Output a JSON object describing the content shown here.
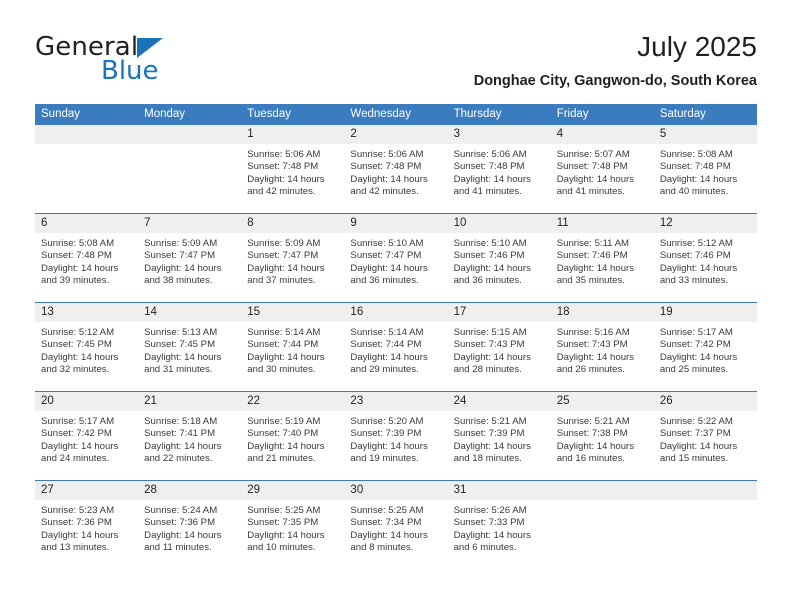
{
  "logo": {
    "word1": "General",
    "word2": "Blue",
    "triangle_color": "#1a73bb"
  },
  "header": {
    "title": "July 2025",
    "subtitle": "Donghae City, Gangwon-do, South Korea"
  },
  "theme": {
    "header_blue": "#3b7cbf",
    "daynum_bg": "#efefef",
    "text": "#231f20"
  },
  "weekday_headers": [
    "Sunday",
    "Monday",
    "Tuesday",
    "Wednesday",
    "Thursday",
    "Friday",
    "Saturday"
  ],
  "weeks": [
    [
      {
        "day": "",
        "sunrise": "",
        "sunset": "",
        "daylight_1": "",
        "daylight_2": ""
      },
      {
        "day": "",
        "sunrise": "",
        "sunset": "",
        "daylight_1": "",
        "daylight_2": ""
      },
      {
        "day": "1",
        "sunrise": "Sunrise: 5:06 AM",
        "sunset": "Sunset: 7:48 PM",
        "daylight_1": "Daylight: 14 hours",
        "daylight_2": "and 42 minutes."
      },
      {
        "day": "2",
        "sunrise": "Sunrise: 5:06 AM",
        "sunset": "Sunset: 7:48 PM",
        "daylight_1": "Daylight: 14 hours",
        "daylight_2": "and 42 minutes."
      },
      {
        "day": "3",
        "sunrise": "Sunrise: 5:06 AM",
        "sunset": "Sunset: 7:48 PM",
        "daylight_1": "Daylight: 14 hours",
        "daylight_2": "and 41 minutes."
      },
      {
        "day": "4",
        "sunrise": "Sunrise: 5:07 AM",
        "sunset": "Sunset: 7:48 PM",
        "daylight_1": "Daylight: 14 hours",
        "daylight_2": "and 41 minutes."
      },
      {
        "day": "5",
        "sunrise": "Sunrise: 5:08 AM",
        "sunset": "Sunset: 7:48 PM",
        "daylight_1": "Daylight: 14 hours",
        "daylight_2": "and 40 minutes."
      }
    ],
    [
      {
        "day": "6",
        "sunrise": "Sunrise: 5:08 AM",
        "sunset": "Sunset: 7:48 PM",
        "daylight_1": "Daylight: 14 hours",
        "daylight_2": "and 39 minutes."
      },
      {
        "day": "7",
        "sunrise": "Sunrise: 5:09 AM",
        "sunset": "Sunset: 7:47 PM",
        "daylight_1": "Daylight: 14 hours",
        "daylight_2": "and 38 minutes."
      },
      {
        "day": "8",
        "sunrise": "Sunrise: 5:09 AM",
        "sunset": "Sunset: 7:47 PM",
        "daylight_1": "Daylight: 14 hours",
        "daylight_2": "and 37 minutes."
      },
      {
        "day": "9",
        "sunrise": "Sunrise: 5:10 AM",
        "sunset": "Sunset: 7:47 PM",
        "daylight_1": "Daylight: 14 hours",
        "daylight_2": "and 36 minutes."
      },
      {
        "day": "10",
        "sunrise": "Sunrise: 5:10 AM",
        "sunset": "Sunset: 7:46 PM",
        "daylight_1": "Daylight: 14 hours",
        "daylight_2": "and 36 minutes."
      },
      {
        "day": "11",
        "sunrise": "Sunrise: 5:11 AM",
        "sunset": "Sunset: 7:46 PM",
        "daylight_1": "Daylight: 14 hours",
        "daylight_2": "and 35 minutes."
      },
      {
        "day": "12",
        "sunrise": "Sunrise: 5:12 AM",
        "sunset": "Sunset: 7:46 PM",
        "daylight_1": "Daylight: 14 hours",
        "daylight_2": "and 33 minutes."
      }
    ],
    [
      {
        "day": "13",
        "sunrise": "Sunrise: 5:12 AM",
        "sunset": "Sunset: 7:45 PM",
        "daylight_1": "Daylight: 14 hours",
        "daylight_2": "and 32 minutes."
      },
      {
        "day": "14",
        "sunrise": "Sunrise: 5:13 AM",
        "sunset": "Sunset: 7:45 PM",
        "daylight_1": "Daylight: 14 hours",
        "daylight_2": "and 31 minutes."
      },
      {
        "day": "15",
        "sunrise": "Sunrise: 5:14 AM",
        "sunset": "Sunset: 7:44 PM",
        "daylight_1": "Daylight: 14 hours",
        "daylight_2": "and 30 minutes."
      },
      {
        "day": "16",
        "sunrise": "Sunrise: 5:14 AM",
        "sunset": "Sunset: 7:44 PM",
        "daylight_1": "Daylight: 14 hours",
        "daylight_2": "and 29 minutes."
      },
      {
        "day": "17",
        "sunrise": "Sunrise: 5:15 AM",
        "sunset": "Sunset: 7:43 PM",
        "daylight_1": "Daylight: 14 hours",
        "daylight_2": "and 28 minutes."
      },
      {
        "day": "18",
        "sunrise": "Sunrise: 5:16 AM",
        "sunset": "Sunset: 7:43 PM",
        "daylight_1": "Daylight: 14 hours",
        "daylight_2": "and 26 minutes."
      },
      {
        "day": "19",
        "sunrise": "Sunrise: 5:17 AM",
        "sunset": "Sunset: 7:42 PM",
        "daylight_1": "Daylight: 14 hours",
        "daylight_2": "and 25 minutes."
      }
    ],
    [
      {
        "day": "20",
        "sunrise": "Sunrise: 5:17 AM",
        "sunset": "Sunset: 7:42 PM",
        "daylight_1": "Daylight: 14 hours",
        "daylight_2": "and 24 minutes."
      },
      {
        "day": "21",
        "sunrise": "Sunrise: 5:18 AM",
        "sunset": "Sunset: 7:41 PM",
        "daylight_1": "Daylight: 14 hours",
        "daylight_2": "and 22 minutes."
      },
      {
        "day": "22",
        "sunrise": "Sunrise: 5:19 AM",
        "sunset": "Sunset: 7:40 PM",
        "daylight_1": "Daylight: 14 hours",
        "daylight_2": "and 21 minutes."
      },
      {
        "day": "23",
        "sunrise": "Sunrise: 5:20 AM",
        "sunset": "Sunset: 7:39 PM",
        "daylight_1": "Daylight: 14 hours",
        "daylight_2": "and 19 minutes."
      },
      {
        "day": "24",
        "sunrise": "Sunrise: 5:21 AM",
        "sunset": "Sunset: 7:39 PM",
        "daylight_1": "Daylight: 14 hours",
        "daylight_2": "and 18 minutes."
      },
      {
        "day": "25",
        "sunrise": "Sunrise: 5:21 AM",
        "sunset": "Sunset: 7:38 PM",
        "daylight_1": "Daylight: 14 hours",
        "daylight_2": "and 16 minutes."
      },
      {
        "day": "26",
        "sunrise": "Sunrise: 5:22 AM",
        "sunset": "Sunset: 7:37 PM",
        "daylight_1": "Daylight: 14 hours",
        "daylight_2": "and 15 minutes."
      }
    ],
    [
      {
        "day": "27",
        "sunrise": "Sunrise: 5:23 AM",
        "sunset": "Sunset: 7:36 PM",
        "daylight_1": "Daylight: 14 hours",
        "daylight_2": "and 13 minutes."
      },
      {
        "day": "28",
        "sunrise": "Sunrise: 5:24 AM",
        "sunset": "Sunset: 7:36 PM",
        "daylight_1": "Daylight: 14 hours",
        "daylight_2": "and 11 minutes."
      },
      {
        "day": "29",
        "sunrise": "Sunrise: 5:25 AM",
        "sunset": "Sunset: 7:35 PM",
        "daylight_1": "Daylight: 14 hours",
        "daylight_2": "and 10 minutes."
      },
      {
        "day": "30",
        "sunrise": "Sunrise: 5:25 AM",
        "sunset": "Sunset: 7:34 PM",
        "daylight_1": "Daylight: 14 hours",
        "daylight_2": "and 8 minutes."
      },
      {
        "day": "31",
        "sunrise": "Sunrise: 5:26 AM",
        "sunset": "Sunset: 7:33 PM",
        "daylight_1": "Daylight: 14 hours",
        "daylight_2": "and 6 minutes."
      },
      {
        "day": "",
        "sunrise": "",
        "sunset": "",
        "daylight_1": "",
        "daylight_2": ""
      },
      {
        "day": "",
        "sunrise": "",
        "sunset": "",
        "daylight_1": "",
        "daylight_2": ""
      }
    ]
  ]
}
